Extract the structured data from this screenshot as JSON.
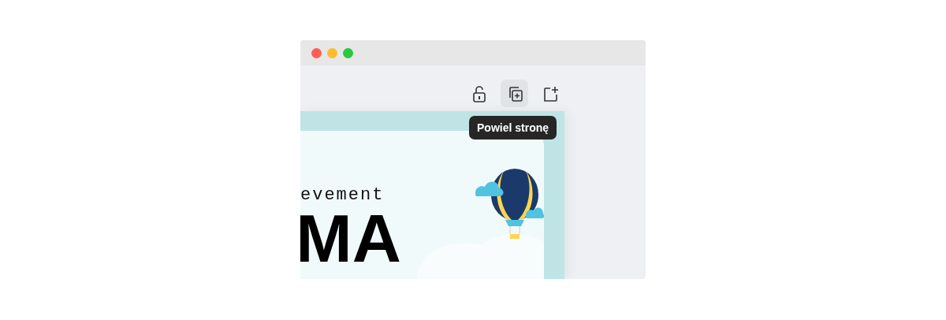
{
  "window": {
    "controls": [
      {
        "kind": "close"
      },
      {
        "kind": "minimize"
      },
      {
        "kind": "zoom"
      }
    ]
  },
  "toolbar": {
    "buttons": [
      {
        "kind": "lock",
        "selected": false
      },
      {
        "kind": "duplicate",
        "selected": true
      },
      {
        "kind": "add",
        "selected": false
      }
    ],
    "tooltip": "Powiel stronę"
  },
  "design": {
    "subtitle": "evement",
    "title": "MA"
  }
}
